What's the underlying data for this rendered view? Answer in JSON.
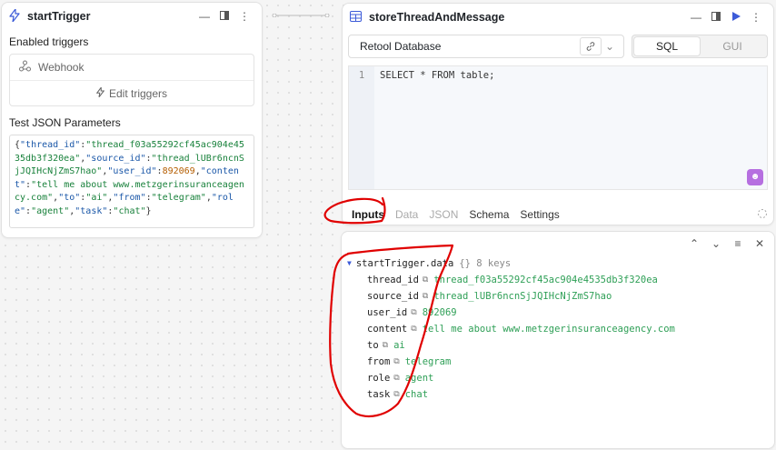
{
  "left_card": {
    "title": "startTrigger",
    "enabled_label": "Enabled triggers",
    "webhook_label": "Webhook",
    "edit_label": "Edit triggers",
    "params_label": "Test JSON Parameters",
    "json_text": [
      {
        "t": "{",
        "c": "p"
      },
      {
        "t": "\"thread_id\"",
        "c": "k"
      },
      {
        "t": ":",
        "c": "p"
      },
      {
        "t": "\"thread_f03a55292cf45ac904e4535db3f320ea\"",
        "c": "s"
      },
      {
        "t": ",",
        "c": "p"
      },
      {
        "t": "\"source_id\"",
        "c": "k"
      },
      {
        "t": ":",
        "c": "p"
      },
      {
        "t": "\"thread_lUBr6ncnSjJQIHcNjZmS7hao\"",
        "c": "s"
      },
      {
        "t": ",",
        "c": "p"
      },
      {
        "t": "\"user_id\"",
        "c": "k"
      },
      {
        "t": ":",
        "c": "p"
      },
      {
        "t": "892069",
        "c": "n"
      },
      {
        "t": ",",
        "c": "p"
      },
      {
        "t": "\"content\"",
        "c": "k"
      },
      {
        "t": ":",
        "c": "p"
      },
      {
        "t": "\"tell me about www.metzgerinsuranceagency.com\"",
        "c": "s"
      },
      {
        "t": ",",
        "c": "p"
      },
      {
        "t": "\"to\"",
        "c": "k"
      },
      {
        "t": ":",
        "c": "p"
      },
      {
        "t": "\"ai\"",
        "c": "s"
      },
      {
        "t": ",",
        "c": "p"
      },
      {
        "t": "\"from\"",
        "c": "k"
      },
      {
        "t": ":",
        "c": "p"
      },
      {
        "t": "\"telegram\"",
        "c": "s"
      },
      {
        "t": ",",
        "c": "p"
      },
      {
        "t": "\"role\"",
        "c": "k"
      },
      {
        "t": ":",
        "c": "p"
      },
      {
        "t": "\"agent\"",
        "c": "s"
      },
      {
        "t": ",",
        "c": "p"
      },
      {
        "t": "\"task\"",
        "c": "k"
      },
      {
        "t": ":",
        "c": "p"
      },
      {
        "t": "\"chat\"",
        "c": "s"
      },
      {
        "t": "}",
        "c": "p"
      }
    ]
  },
  "query_card": {
    "title": "storeThreadAndMessage",
    "resource": "Retool Database",
    "mode_sql": "SQL",
    "mode_gui": "GUI",
    "line_number": "1",
    "code": "SELECT * FROM table;",
    "subtabs": [
      "Inputs",
      "Data",
      "JSON",
      "Schema",
      "Settings"
    ]
  },
  "data_panel": {
    "root_key": "startTrigger.data",
    "root_meta": "{} 8 keys",
    "rows": [
      {
        "key": "thread_id",
        "value": "thread_f03a55292cf45ac904e4535db3f320ea"
      },
      {
        "key": "source_id",
        "value": "thread_lUBr6ncnSjJQIHcNjZmS7hao"
      },
      {
        "key": "user_id",
        "value": "892069"
      },
      {
        "key": "content",
        "value": "tell me about www.metzgerinsuranceagency.com"
      },
      {
        "key": "to",
        "value": "ai"
      },
      {
        "key": "from",
        "value": "telegram"
      },
      {
        "key": "role",
        "value": "agent"
      },
      {
        "key": "task",
        "value": "chat"
      }
    ]
  },
  "colors": {
    "accent_blue": "#3c5bd8",
    "annotation_red": "#e00000",
    "value_green": "#2e9f56"
  }
}
